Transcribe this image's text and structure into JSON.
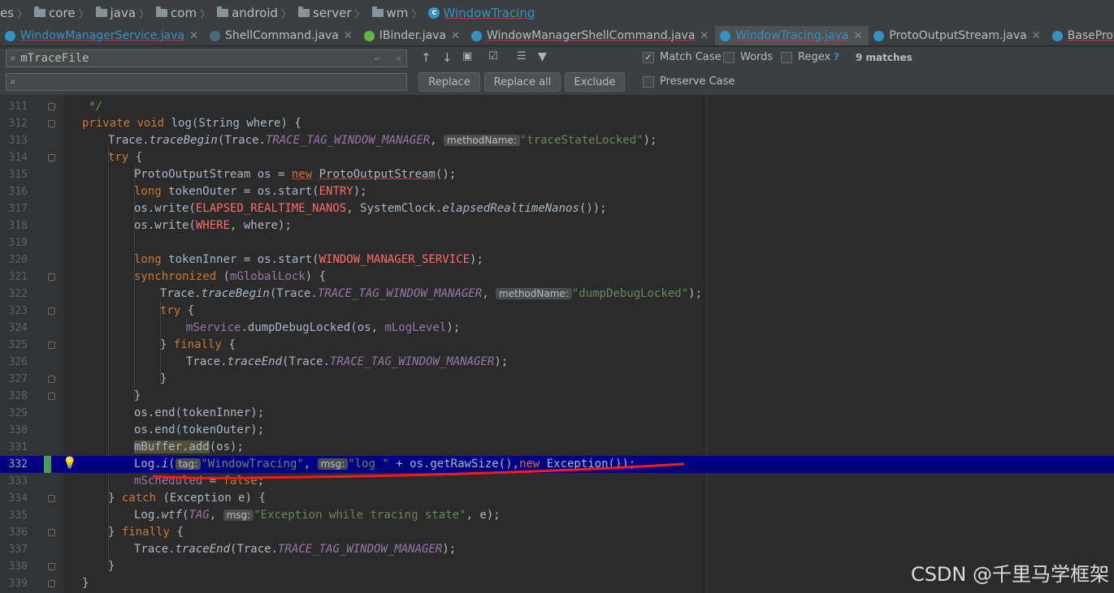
{
  "breadcrumb": [
    "es",
    "core",
    "java",
    "com",
    "android",
    "server",
    "wm",
    "WindowTracing"
  ],
  "tabs": [
    {
      "label": "WindowManagerService.java"
    },
    {
      "label": "ShellCommand.java"
    },
    {
      "label": "IBinder.java"
    },
    {
      "label": "WindowManagerShellCommand.java"
    },
    {
      "label": "WindowTracing.java"
    },
    {
      "label": "ProtoOutputStream.java"
    },
    {
      "label": "BaseProto"
    }
  ],
  "search": {
    "find_value": "mTraceFile",
    "replace_value": "",
    "replace_label": "Replace",
    "replace_all_label": "Replace all",
    "exclude_label": "Exclude",
    "match_case_label": "Match Case",
    "words_label": "Words",
    "regex_label": "Regex",
    "help_mark": "?",
    "preserve_case_label": "Preserve Case",
    "matches_label": "9 matches"
  },
  "line_numbers": [
    "311",
    "312",
    "313",
    "314",
    "315",
    "316",
    "317",
    "318",
    "319",
    "320",
    "321",
    "322",
    "323",
    "324",
    "325",
    "326",
    "327",
    "328",
    "329",
    "330",
    "331",
    "332",
    "333",
    "334",
    "335",
    "336",
    "337",
    "338",
    "339"
  ],
  "code": {
    "comment_end": " */",
    "private": "private",
    "void": "void",
    "log_sig": " log(String where) {",
    "trace": "Trace.",
    "traceBegin": "traceBegin",
    "trace_tag_open": "(Trace.",
    "TRACE_TAG": "TRACE_TAG_WINDOW_MANAGER",
    "comma": ", ",
    "hint_methodName": "methodName:",
    "str_traceStateLocked": "\"traceStateLocked\"",
    "close_paren_semi": ");",
    "try": "try",
    "open_brace": " {",
    "pos_decl": "ProtoOutputStream os = ",
    "new": "new",
    "pos_ctor": "ProtoOutputStream",
    "paren_semi": "();",
    "long": "long",
    "tokenOuter_decl": " tokenOuter = os.start(",
    "ENTRY": "ENTRY",
    "os_write": "os.write(",
    "ELAPSED": "ELAPSED_REALTIME_NANOS",
    "sysclock": ", SystemClock.",
    "elapsedRealtimeNanos": "elapsedRealtimeNanos",
    "double_close": "());",
    "WHERE": "WHERE",
    "where_end": ", where);",
    "tokenInner_decl": " tokenInner = os.start(",
    "WMS": "WINDOW_MANAGER_SERVICE",
    "synchronized": "synchronized",
    "sync_open": " (",
    "mGlobalLock": "mGlobalLock",
    "sync_close": ") {",
    "str_dumpDebugLocked": "\"dumpDebugLocked\"",
    "mService": "mService",
    "dump_call": ".dumpDebugLocked(os, ",
    "mLogLevel": "mLogLevel",
    "close_brace": "}",
    "finally": "finally",
    "traceEnd": "traceEnd",
    "os_end_inner": "os.end(tokenInner);",
    "os_end_outer": "os.end(tokenOuter);",
    "mBuffer": "mBuffer",
    "dot_add": ".add",
    "add_args": "(os);",
    "log_i": "Log.",
    "i": "i",
    "open_paren": "(",
    "hint_tag": "tag:",
    "str_WindowTracing": "\"WindowTracing\"",
    "hint_msg": "msg:",
    "str_log": "\"log \"",
    "rawsize": " + os.getRawSize(),",
    "exception_call": "Exception());",
    "mScheduled": "mScheduled",
    "eq_false": " = ",
    "false": "false",
    "semi": ";",
    "catch": "catch",
    "catch_args": " (Exception e) {",
    "wtf": "wtf",
    "TAG": "TAG",
    "str_exception": "\"Exception while tracing state\"",
    "wtf_end": ", e);"
  },
  "watermark": "CSDN @千里马学框架",
  "colors": {
    "keyword": "#cc7832",
    "string": "#6a8759",
    "field": "#9876aa",
    "current_line": "#000080",
    "annotation_underline": "#ff0000"
  },
  "icons": [
    "folder-icon",
    "class-icon",
    "close-icon",
    "search-icon",
    "arrow-up-icon",
    "arrow-down-icon",
    "filter-icon",
    "lightbulb-icon"
  ]
}
